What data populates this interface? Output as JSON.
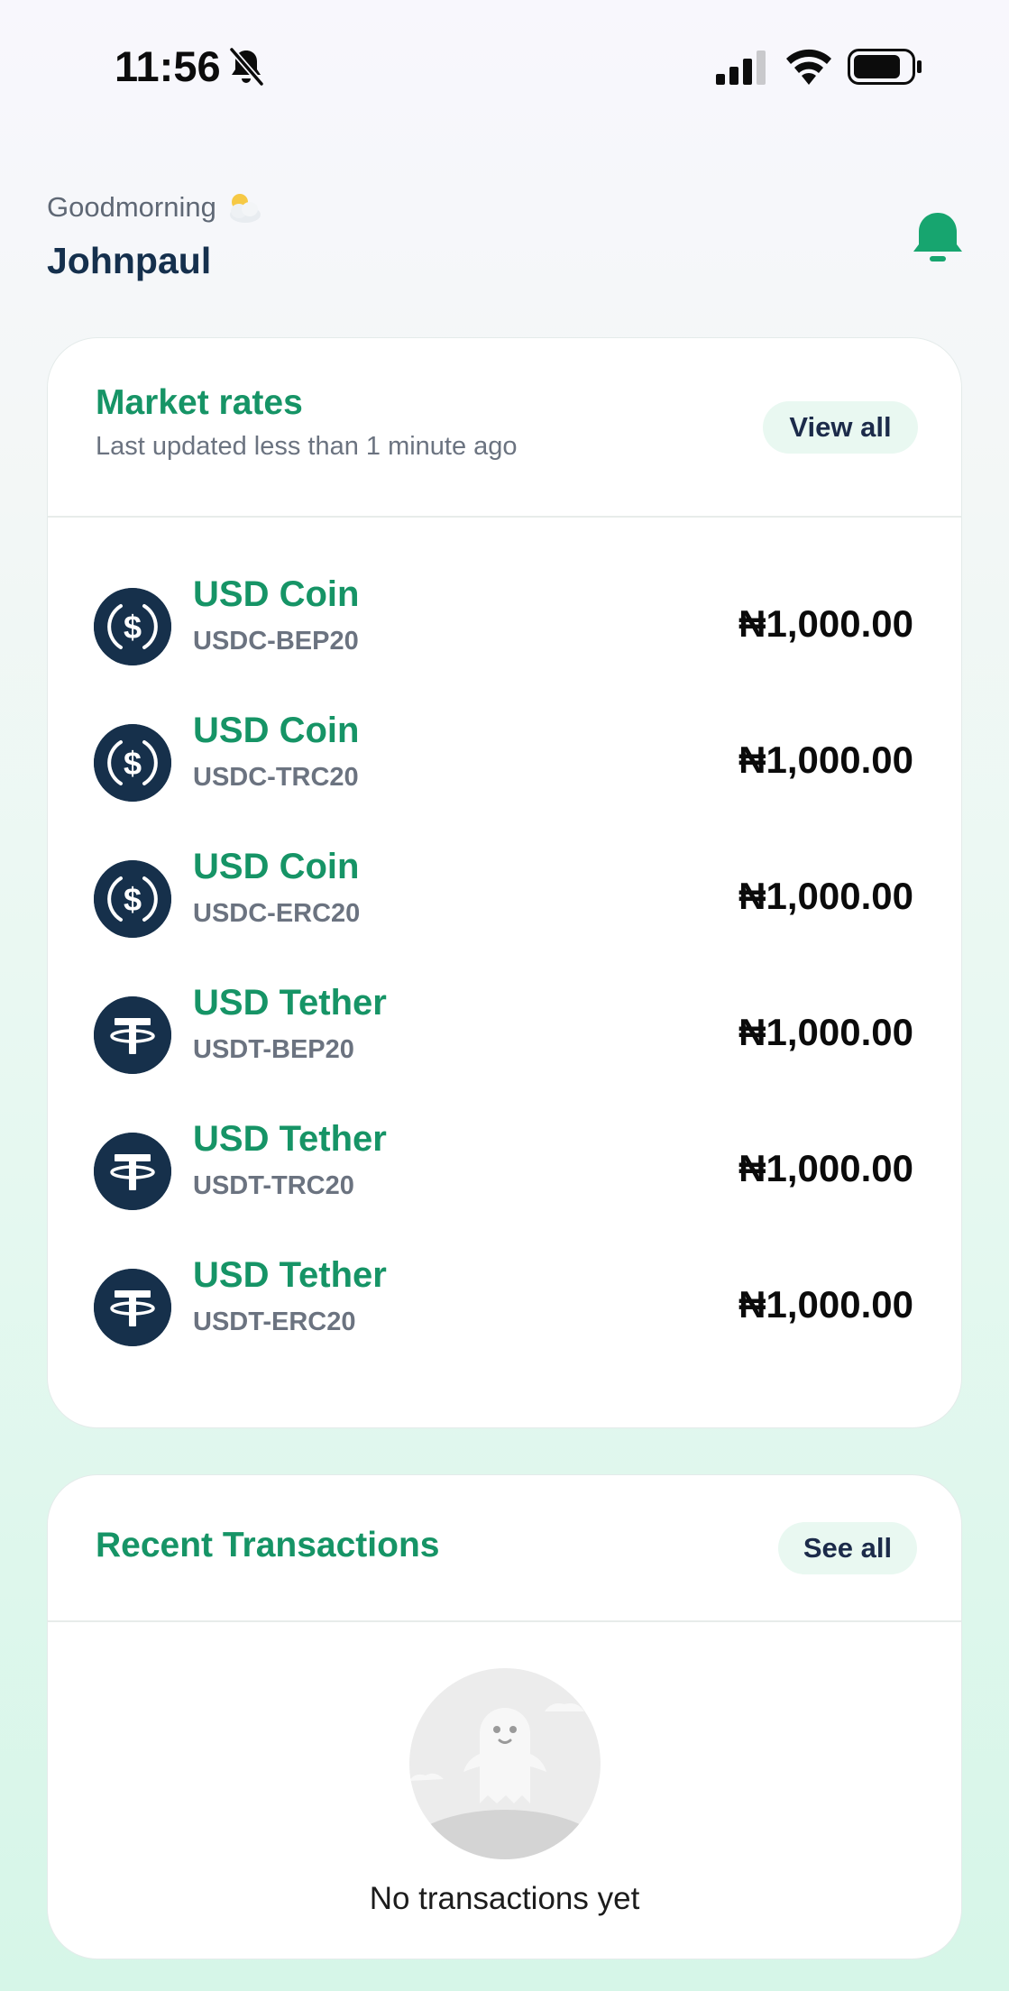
{
  "status_bar": {
    "time": "11:56"
  },
  "greeting": {
    "text": "Goodmorning",
    "name": "Johnpaul"
  },
  "market": {
    "title": "Market rates",
    "subtitle": "Last updated less than 1 minute ago",
    "view_all": "View all",
    "rates": [
      {
        "name": "USD Coin",
        "code": "USDC-BEP20",
        "price": "₦1,000.00",
        "icon": "usdc-icon"
      },
      {
        "name": "USD Coin",
        "code": "USDC-TRC20",
        "price": "₦1,000.00",
        "icon": "usdc-icon"
      },
      {
        "name": "USD Coin",
        "code": "USDC-ERC20",
        "price": "₦1,000.00",
        "icon": "usdc-icon"
      },
      {
        "name": "USD Tether",
        "code": "USDT-BEP20",
        "price": "₦1,000.00",
        "icon": "usdt-icon"
      },
      {
        "name": "USD Tether",
        "code": "USDT-TRC20",
        "price": "₦1,000.00",
        "icon": "usdt-icon"
      },
      {
        "name": "USD Tether",
        "code": "USDT-ERC20",
        "price": "₦1,000.00",
        "icon": "usdt-icon"
      }
    ]
  },
  "transactions": {
    "title": "Recent Transactions",
    "see_all": "See all",
    "empty_text": "No transactions yet"
  },
  "colors": {
    "brand_green": "#169466",
    "navy": "#16304b",
    "pill_bg": "#e9f8f1"
  }
}
